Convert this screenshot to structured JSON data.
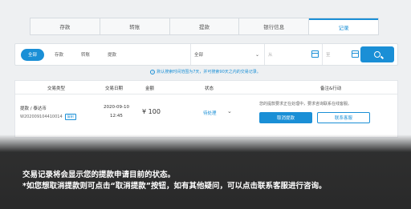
{
  "tabs": [
    {
      "label": "存款",
      "active": false
    },
    {
      "label": "转账",
      "active": false
    },
    {
      "label": "提款",
      "active": false
    },
    {
      "label": "银行信息",
      "active": false
    },
    {
      "label": "记录",
      "active": true
    }
  ],
  "filter": {
    "types": [
      "全部",
      "存款",
      "转账",
      "提款"
    ],
    "status_select": "全部",
    "date_from_placeholder": "从",
    "date_to_placeholder": "至"
  },
  "notice": "默认搜索时间范围为7天，并可搜索90天之内的交易记录。",
  "table": {
    "headers": [
      "交易类型",
      "交易日期",
      "金额",
      "状态",
      "备注&行动"
    ],
    "row": {
      "type": "提款 / 泰达币",
      "id": "W202009104410014",
      "copy_label": "复制",
      "date": "2020-09-10",
      "time": "12:45",
      "currency": "¥",
      "amount": "100",
      "status": "待处理",
      "remark": "您的提款要求正在处理中，要求咨询联系在线客服。",
      "cancel_label": "取消提款",
      "contact_label": "联系客服"
    }
  },
  "caption": {
    "line1": "交易记录将会显示您的提款申请目前的状态。",
    "line2": "*如您想取消提款则可点击“取消提款”按钮，如有其他疑问，可以点击联系客服进行咨询。"
  },
  "colors": {
    "accent": "#1a8fd6"
  }
}
